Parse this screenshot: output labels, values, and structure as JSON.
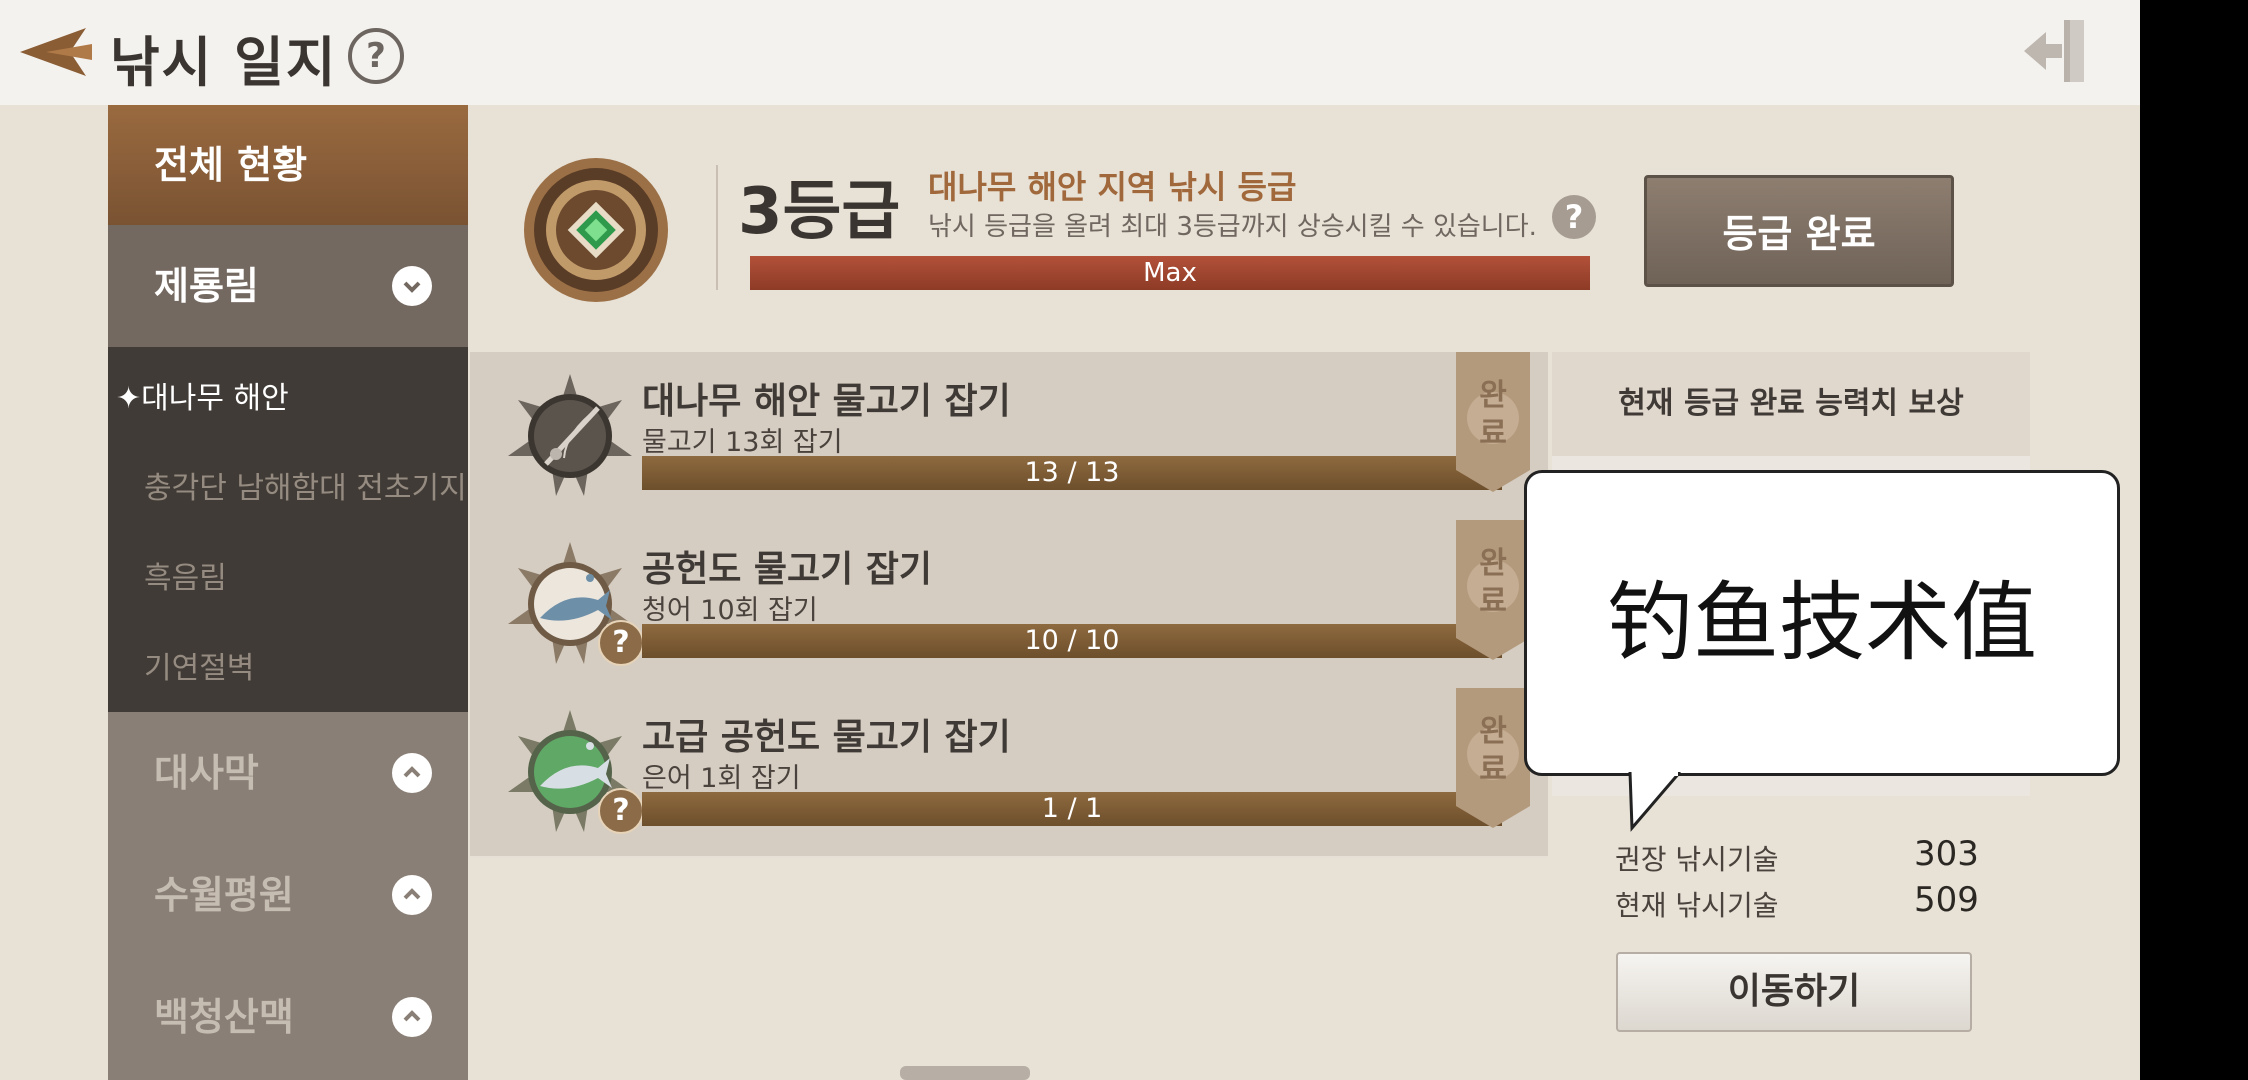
{
  "header": {
    "title": "낚시 일지",
    "help_glyph": "?"
  },
  "sidebar": {
    "overall_label": "전체 현황",
    "groups": [
      {
        "label": "제룡림",
        "expanded": true,
        "items": [
          "대나무 해안",
          "충각단 남해함대 전초기지",
          "흑음림",
          "기연절벽"
        ],
        "active_item": "대나무 해안"
      },
      {
        "label": "대사막",
        "expanded": false
      },
      {
        "label": "수월평원",
        "expanded": false
      },
      {
        "label": "백청산맥",
        "expanded": false
      }
    ]
  },
  "grade": {
    "level": "3등급",
    "region_title": "대나무 해안 지역 낚시 등급",
    "description": "낚시 등급을 올려 최대 3등급까지 상승시킬 수 있습니다.",
    "help_glyph": "?",
    "progress_label": "Max",
    "progress": 1.0,
    "complete_button": "등급 완료"
  },
  "quests": [
    {
      "title": "대나무 해안 물고기 잡기",
      "subtitle": "물고기 13회 잡기",
      "progress": "13 / 13",
      "status": [
        "완",
        "료"
      ]
    },
    {
      "title": "공헌도 물고기 잡기",
      "subtitle": "청어 10회 잡기",
      "progress": "10 / 10",
      "status": [
        "완",
        "료"
      ],
      "badge": "?"
    },
    {
      "title": "고급 공헌도 물고기 잡기",
      "subtitle": "은어 1회 잡기",
      "progress": "1 / 1",
      "status": [
        "완",
        "료"
      ],
      "badge": "?"
    }
  ],
  "reward_panel": {
    "heading": "현재 등급 완료 능력치 보상",
    "recommended_label": "권장 낚시기술",
    "recommended_value": "303",
    "current_label": "현재 낚시기술",
    "current_value": "509",
    "move_button": "이동하기"
  },
  "overlay": {
    "bubble_text": "钓鱼技术值"
  },
  "colors": {
    "accent_brown": "#8d5f38",
    "progress_red": "#a3462f",
    "quest_bar": "#7e5d36",
    "sidebar_dark": "#403b36"
  }
}
